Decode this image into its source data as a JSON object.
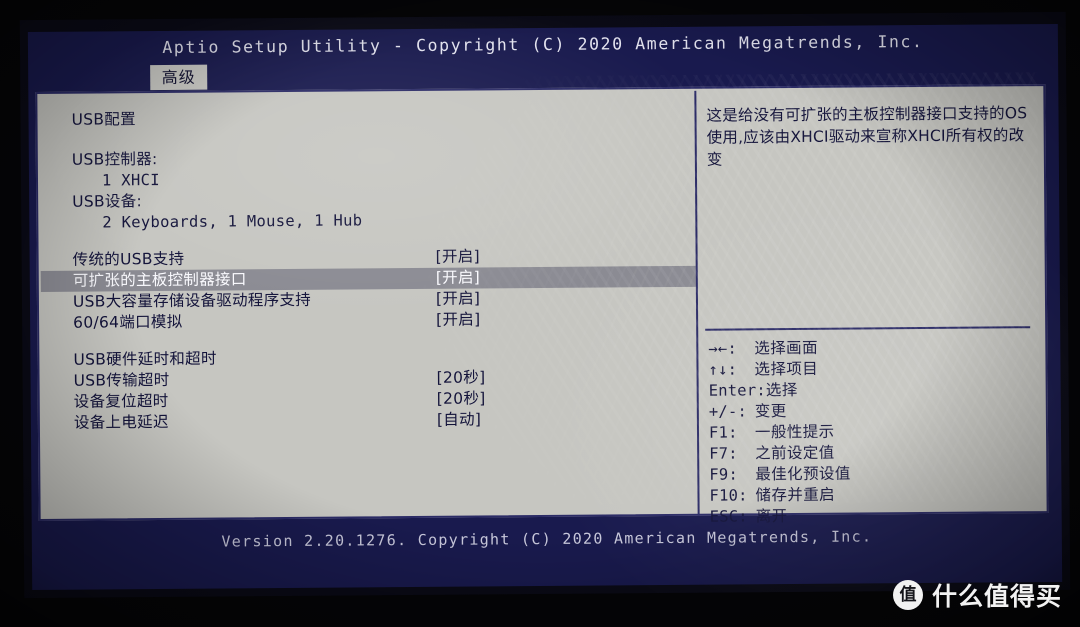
{
  "header": {
    "title": "Aptio Setup Utility - Copyright (C) 2020 American Megatrends, Inc.",
    "tabs": [
      {
        "label": "高级",
        "active": true
      }
    ]
  },
  "left_pane": {
    "section_title": "USB配置",
    "rows": [
      {
        "label": "USB控制器:",
        "value": "",
        "indent": false,
        "selected": false,
        "mono": false
      },
      {
        "label": "1 XHCI",
        "value": "",
        "indent": true,
        "selected": false,
        "mono": true
      },
      {
        "label": "USB设备:",
        "value": "",
        "indent": false,
        "selected": false,
        "mono": false
      },
      {
        "label": "2 Keyboards, 1 Mouse, 1 Hub",
        "value": "",
        "indent": true,
        "selected": false,
        "mono": true
      },
      {
        "label": "传统的USB支持",
        "value": "[开启]",
        "indent": false,
        "selected": false,
        "mono": false
      },
      {
        "label": "可扩张的主板控制器接口",
        "value": "[开启]",
        "indent": false,
        "selected": true,
        "mono": false
      },
      {
        "label": "USB大容量存储设备驱动程序支持",
        "value": "[开启]",
        "indent": false,
        "selected": false,
        "mono": false
      },
      {
        "label": "60/64端口模拟",
        "value": "[开启]",
        "indent": false,
        "selected": false,
        "mono": false
      },
      {
        "label": "USB硬件延时和超时",
        "value": "",
        "indent": false,
        "selected": false,
        "mono": false
      },
      {
        "label": "USB传输超时",
        "value": "[20秒]",
        "indent": false,
        "selected": false,
        "mono": false
      },
      {
        "label": "设备复位超时",
        "value": "[20秒]",
        "indent": false,
        "selected": false,
        "mono": false
      },
      {
        "label": "设备上电延迟",
        "value": "[自动]",
        "indent": false,
        "selected": false,
        "mono": false
      }
    ]
  },
  "right_pane": {
    "help_text": "这是给没有可扩张的主板控制器接口支持的OS使用,应该由XHCI驱动来宣称XHCI所有权的改变",
    "key_legend": [
      {
        "key": "→←:",
        "desc": "选择画面"
      },
      {
        "key": "↑↓:",
        "desc": "选择项目"
      },
      {
        "key": "Enter:",
        "desc": "选择"
      },
      {
        "key": "+/-:",
        "desc": "变更"
      },
      {
        "key": "F1:",
        "desc": "一般性提示"
      },
      {
        "key": "F7:",
        "desc": "之前设定值"
      },
      {
        "key": "F9:",
        "desc": "最佳化预设值"
      },
      {
        "key": "F10:",
        "desc": "储存并重启"
      },
      {
        "key": "ESC:",
        "desc": "离开"
      }
    ]
  },
  "footer": {
    "version": "Version 2.20.1276. Copyright (C) 2020 American Megatrends, Inc."
  },
  "watermark": {
    "badge": "值",
    "text": "什么值得买"
  },
  "colors": {
    "bios_blue": "#191a4e",
    "panel_gray": "#c6c6c1",
    "border_navy": "#2b2b66",
    "text_navy": "#13133a",
    "selected_bg": "#8b8b93",
    "selected_text": "#fbfbff"
  }
}
